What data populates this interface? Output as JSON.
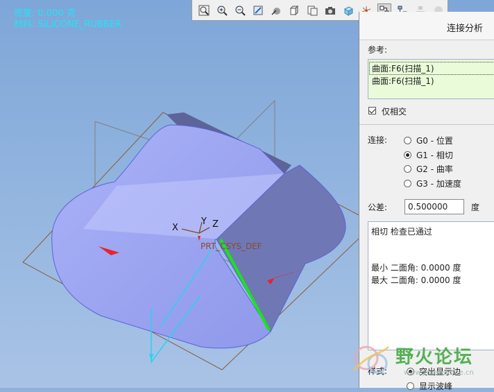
{
  "hud": {
    "density_line": "密度: 0.000 克",
    "material_line": "材料: SILICONE_RUBBER"
  },
  "toolbar": {
    "buttons": [
      {
        "name": "zoom-fit-icon"
      },
      {
        "name": "zoom-in-icon"
      },
      {
        "name": "zoom-out-icon"
      },
      {
        "name": "repaint-icon"
      },
      {
        "name": "spin-center-icon"
      },
      {
        "name": "saved-view-icon"
      },
      {
        "name": "view-manager-icon"
      },
      {
        "name": "camera-icon"
      },
      {
        "name": "display-style-icon"
      },
      {
        "name": "datum-display-icon"
      },
      {
        "name": "connection-analysis-icon",
        "active": true
      },
      {
        "name": "hierarchy-icon"
      },
      {
        "name": "component-icon",
        "disabled": true
      },
      {
        "name": "sphere-icon",
        "disabled": true
      }
    ]
  },
  "viewport": {
    "csys_label": "PRT_CSYS_DEF",
    "axis_x": "X",
    "axis_y": "Y",
    "axis_z": "Z"
  },
  "panel": {
    "title": "连接分析",
    "reference_label": "参考:",
    "references": [
      "曲面:F6(扫描_1)",
      "曲面:F6(扫描_1)"
    ],
    "intersect_only_label": "仅相交",
    "intersect_only_checked": true,
    "connection_label": "连接:",
    "connection_options": [
      "G0 - 位置",
      "G1 - 相切",
      "G2 - 曲率",
      "G3 - 加速度"
    ],
    "connection_selected": "G1 - 相切",
    "tolerance_label": "公差:",
    "tolerance_value": "0.500000",
    "tolerance_unit": "度",
    "result_lines": [
      "相切 检查已通过",
      "最小 二面角: 0.0000 度",
      "最大 二面角: 0.0000 度"
    ],
    "style_label": "样式:",
    "style_options": [
      "突出显示边",
      "显示波峰"
    ],
    "style_selected": "突出显示边"
  },
  "watermark": {
    "text": "野火论坛",
    "url": "www.proewildfire.cn"
  },
  "colors": {
    "viewport_bg": "#8fb1dc",
    "hud_cyan": "#23e3f6",
    "surface": "#9ea6f2",
    "highlight_edge": "#17e617",
    "arrow_red": "#e8232c",
    "watermark_green": "#3aa63a"
  }
}
